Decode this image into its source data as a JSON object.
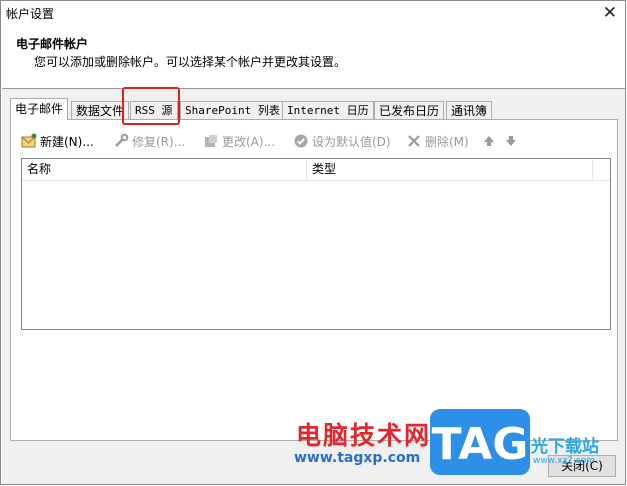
{
  "window": {
    "title": "帐户设置",
    "close_glyph": "✕"
  },
  "header": {
    "title": "电子邮件帐户",
    "subtitle": "您可以添加或删除帐户。可以选择某个帐户并更改其设置。"
  },
  "tabs": [
    {
      "label": "电子邮件",
      "active": true
    },
    {
      "label": "数据文件",
      "active": false
    },
    {
      "label": "RSS 源",
      "active": false
    },
    {
      "label": "SharePoint 列表",
      "active": false
    },
    {
      "label": "Internet 日历",
      "active": false
    },
    {
      "label": "已发布日历",
      "active": false
    },
    {
      "label": "通讯簿",
      "active": false
    }
  ],
  "toolbar": {
    "new_label": "新建(N)...",
    "repair_label": "修复(R)...",
    "change_label": "更改(A)...",
    "set_default_label": "设为默认值(D)",
    "remove_label": "删除(M)",
    "up_glyph": "🡅",
    "down_glyph": "🡇"
  },
  "list": {
    "columns": [
      "名称",
      "类型"
    ]
  },
  "footer": {
    "close_label": "关闭(C)"
  },
  "watermark": {
    "cn_text": "电脑技术网",
    "url": "www.tagxp.com",
    "badge_text": "TAG",
    "right_text": "光下载站",
    "right_url": "www.xz7.com"
  },
  "colors": {
    "highlight": "#e02020",
    "disabled_text": "#9a9a9a",
    "badge": "#2d8fe8"
  }
}
